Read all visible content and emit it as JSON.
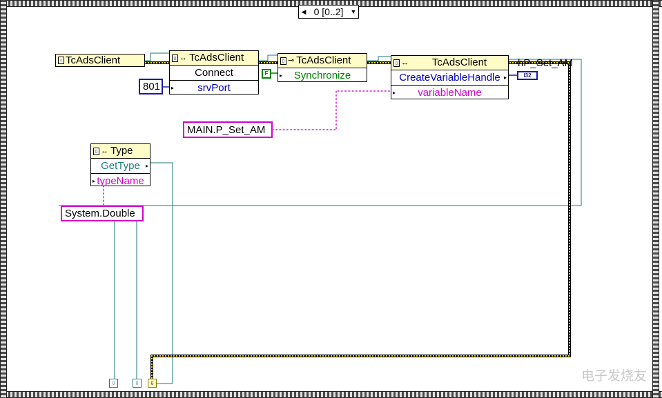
{
  "case_selector": {
    "label": "0 [0..2]",
    "prev_icon": "triangle-left",
    "next_icon": "triangle-right",
    "menu_icon": "triangle-down"
  },
  "nodes": {
    "client_constant": {
      "label": "TcAdsClient"
    },
    "connect_node": {
      "class": "TcAdsClient",
      "method": "Connect",
      "param": "srvPort"
    },
    "sync_node": {
      "class": "TcAdsClient",
      "method": "Synchronize"
    },
    "handle_node": {
      "class": "TcAdsClient",
      "method": "CreateVariableHandle",
      "param": "variableName"
    },
    "type_node": {
      "class": "Type",
      "method": "GetType",
      "param": "typeName"
    }
  },
  "constants": {
    "port": "801",
    "variable": "MAIN.P_Set_AM",
    "type_name": "System.Double",
    "false_const": "F",
    "i32_indicator": "I32"
  },
  "labels": {
    "handle_out": "hP_Set_AM"
  },
  "watermark": "电子发烧友",
  "colors": {
    "refnum_wire": "#1a7a7a",
    "string_wire": "#d000d0",
    "error_wire": "#8a7a00",
    "int_wire": "#1a1aa0",
    "bool_wire": "#008000",
    "method_text": "#0000c0",
    "param_text": "#d000d0"
  }
}
